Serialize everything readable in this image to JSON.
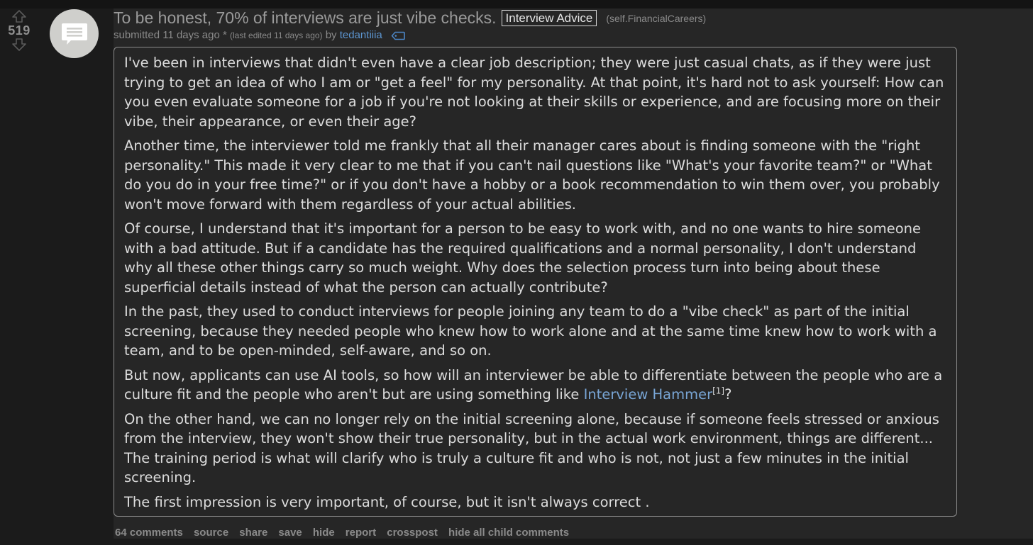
{
  "vote": {
    "score": "519"
  },
  "post": {
    "title": "To be honest, 70% of interviews are just vibe checks.",
    "flair": "Interview Advice",
    "domain": "(self.FinancialCareers)",
    "tagline": {
      "submitted": "submitted 11 days ago",
      "asterisk": " * ",
      "edited": "(last edited 11 days ago)",
      "by": " by ",
      "author": "tedantiiia"
    },
    "body": [
      "I've been in interviews that didn't even have a clear job description; they were just casual chats, as if they were just trying to get an idea of who I am or \"get a feel\" for my personality. At that point, it's hard not to ask yourself: How can you even evaluate someone for a job if you're not looking at their skills or experience, and are focusing more on their vibe, their appearance, or even their age?",
      "Another time, the interviewer told me frankly that all their manager cares about is finding someone with the \"right personality.\" This made it very clear to me that if you can't nail questions like \"What's your favorite team?\" or \"What do you do in your free time?\" or if you don't have a hobby or a book recommendation to win them over, you probably won't move forward with them regardless of your actual abilities.",
      "Of course, I understand that it's important for a person to be easy to work with, and no one wants to hire someone with a bad attitude. But if a candidate has the required qualifications and a normal personality, I don't understand why all these other things carry so much weight. Why does the selection process turn into being about these superficial details instead of what the person can actually contribute?",
      "In the past, they used to conduct interviews for people joining any team to do a \"vibe check\" as part of the initial screening, because they needed people who knew how to work alone and at the same time knew how to work with a team, and to be open-minded, self-aware, and so on."
    ],
    "p5": {
      "before": "But now, applicants can use AI tools, so how will an interviewer be able to differentiate between the people who are a culture fit and the people who aren't but are using something like ",
      "link": "Interview Hammer",
      "ref": "[1]",
      "after": "?"
    },
    "body_end": [
      "On the other hand, we can no longer rely on the initial screening alone, because if someone feels stressed or anxious from the interview, they won't show their true personality, but in the actual work environment, things are different... The training period is what will clarify who is truly a culture fit and who is not, not just a few minutes in the initial screening.",
      "The first impression is very important, of course, but it isn't always correct ."
    ],
    "buttons": [
      "64 comments",
      "source",
      "share",
      "save",
      "hide",
      "report",
      "crosspost",
      "hide all child comments"
    ]
  },
  "icons": {
    "upvote": "up-arrow-icon",
    "downvote": "down-arrow-icon",
    "thumbnail": "self-post-icon",
    "tag": "tag-icon"
  },
  "colors": {
    "background": "#1b1b1b",
    "post_background": "#262626",
    "link": "#79a6d6",
    "author": "#5c95d0",
    "muted": "#8a8a8a",
    "text": "#dcdcdc"
  }
}
